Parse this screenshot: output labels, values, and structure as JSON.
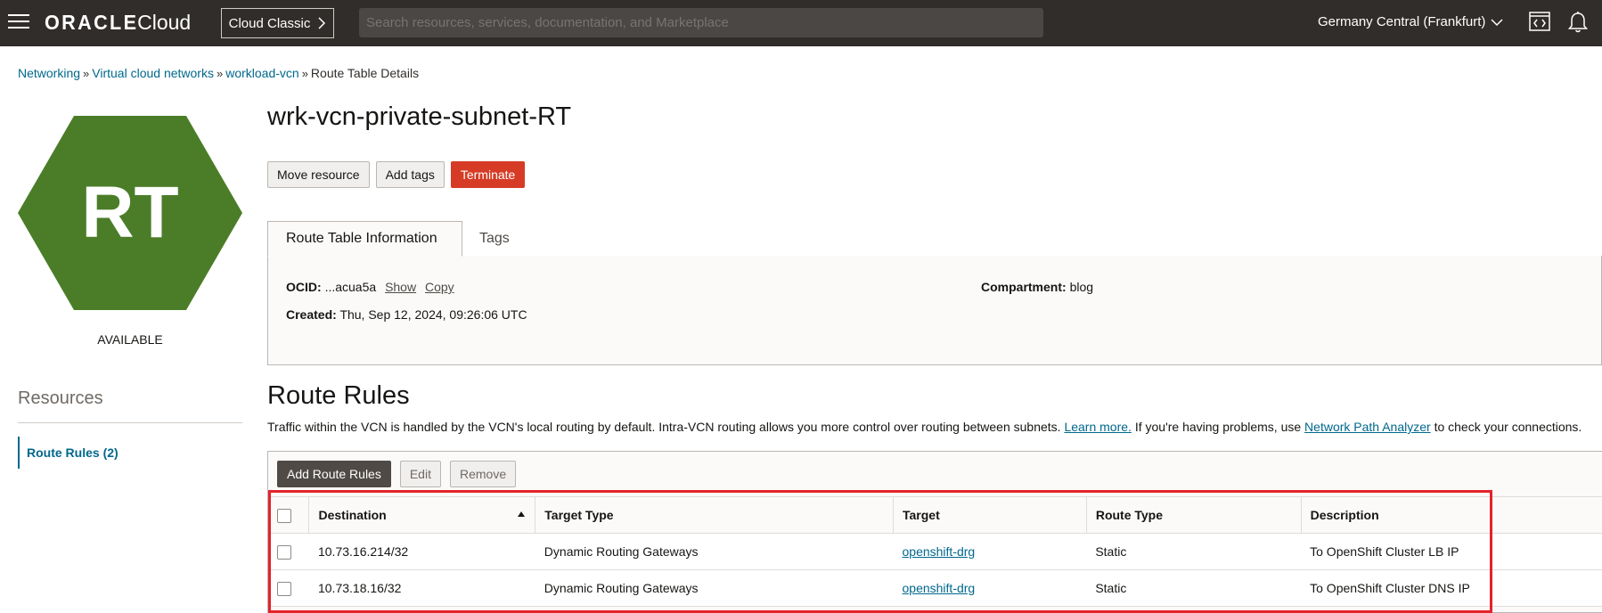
{
  "topbar": {
    "brand_oracle": "ORACLE",
    "brand_cloud": "Cloud",
    "classic_label": "Cloud Classic",
    "search_placeholder": "Search resources, services, documentation, and Marketplace",
    "region": "Germany Central (Frankfurt)"
  },
  "breadcrumb": {
    "items": [
      "Networking",
      "Virtual cloud networks",
      "workload-vcn"
    ],
    "current": "Route Table Details",
    "separator": "»"
  },
  "resource_icon": {
    "abbr": "RT",
    "color": "#4b7d28",
    "status": "AVAILABLE"
  },
  "sidebar": {
    "title": "Resources",
    "items": [
      {
        "label": "Route Rules (2)"
      }
    ]
  },
  "page": {
    "title": "wrk-vcn-private-subnet-RT",
    "actions": [
      "Move resource",
      "Add tags",
      "Terminate"
    ]
  },
  "tabs": [
    "Route Table Information",
    "Tags"
  ],
  "info": {
    "ocid_label": "OCID:",
    "ocid_value": "...acua5a",
    "show": "Show",
    "copy": "Copy",
    "created_label": "Created:",
    "created_value": "Thu, Sep 12, 2024, 09:26:06 UTC",
    "compartment_label": "Compartment:",
    "compartment_value": "blog"
  },
  "route_rules": {
    "title": "Route Rules",
    "desc_1": "Traffic within the VCN is handled by the VCN's local routing by default. Intra-VCN routing allows you more control over routing between subnets.",
    "learn_more": "Learn more.",
    "desc_2": "If you're having problems, use",
    "npa": "Network Path Analyzer",
    "desc_3": "to check your connections.",
    "buttons": [
      "Add Route Rules",
      "Edit",
      "Remove"
    ],
    "columns": [
      "Destination",
      "Target Type",
      "Target",
      "Route Type",
      "Description"
    ],
    "rows": [
      {
        "destination": "10.73.16.214/32",
        "target_type": "Dynamic Routing Gateways",
        "target": "openshift-drg",
        "route_type": "Static",
        "description": "To OpenShift Cluster LB IP"
      },
      {
        "destination": "10.73.18.16/32",
        "target_type": "Dynamic Routing Gateways",
        "target": "openshift-drg",
        "route_type": "Static",
        "description": "To OpenShift Cluster DNS IP"
      }
    ]
  },
  "colors": {
    "topbar": "#312d2a",
    "link": "#00688c",
    "danger": "#d63b25",
    "highlight": "#e3242b"
  }
}
